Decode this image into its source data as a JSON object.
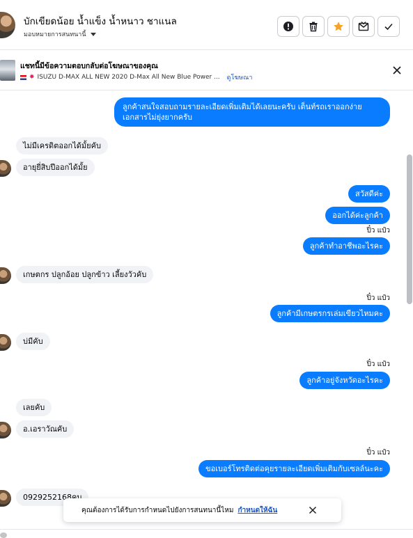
{
  "header": {
    "title": "บักเขียดน้อย น้ำแข็ง น้ำหนาว ชาแนล",
    "assign_label": "มอบหมายการสนทนานี้",
    "buttons": [
      "report-icon",
      "trash-icon",
      "star-icon",
      "mark-unread-icon",
      "check-icon"
    ],
    "star_color": "#f7a325"
  },
  "ad": {
    "title": "แชทนี้มีข้อความตอบกลับต่อโฆษณาของคุณ",
    "description": "ISUZU D-MAX ALL NEW 2020 D-Max All New Blue Power ...",
    "link": "ดูโฆษณา"
  },
  "messages": [
    {
      "dir": "out",
      "text": "ลูกค้าสนใจสอบถามรายละเอียดเพิ่มเติมได้เลยนะครับ เต็นท์รถเราออกง่าย\nเอกสารไม่ยุ่งยากครับ"
    },
    {
      "dir": "in",
      "text": "ไม่มีเครดิตออกได้มั้ยคับ"
    },
    {
      "dir": "in",
      "text": "อายุยี่สิบปีออกได้มั้ย"
    },
    {
      "dir": "out",
      "text": "สวัสดีค่ะ"
    },
    {
      "dir": "out",
      "text": "ออกได้ค่ะลูกค้า"
    },
    {
      "dir": "seen",
      "text": "ปิ๋ว แป๋ว"
    },
    {
      "dir": "out",
      "text": "ลูกค้าทำอาชีพอะไรคะ"
    },
    {
      "dir": "in",
      "text": "เกษตกร ปลูกอ้อย ปลูกข้าว เลี้ยงวัวคับ"
    },
    {
      "dir": "seen",
      "text": "ปิ๋ว แป๋ว"
    },
    {
      "dir": "out",
      "text": "ลูกค้ามีเกษตรกรเล่มเขียวไหมคะ"
    },
    {
      "dir": "in",
      "text": "บ่มีคับ"
    },
    {
      "dir": "seen",
      "text": "ปิ๋ว แป๋ว"
    },
    {
      "dir": "out",
      "text": "ลูกค้าอยู่จังหวัดอะไรคะ"
    },
    {
      "dir": "in",
      "text": "เลยคับ"
    },
    {
      "dir": "in",
      "text": "อ.เอราวัณคับ"
    },
    {
      "dir": "seen",
      "text": "ปิ๋ว แป๋ว"
    },
    {
      "dir": "out",
      "text": "ขอเบอร์โทรติดต่อคุยรายละเอียดเพิ่มเติมกับเซลล์นะคะ"
    },
    {
      "dir": "in",
      "text": "0929252168คบ"
    }
  ],
  "toast": {
    "text": "คุณต้องการได้รับการกำหนดไปยังการสนทนานี้ไหม",
    "action": "กำหนดให้ฉัน"
  },
  "colors": {
    "outgoing_bubble": "#0a7cff",
    "incoming_bubble": "#f0f2f5",
    "link": "#1a56c4"
  }
}
